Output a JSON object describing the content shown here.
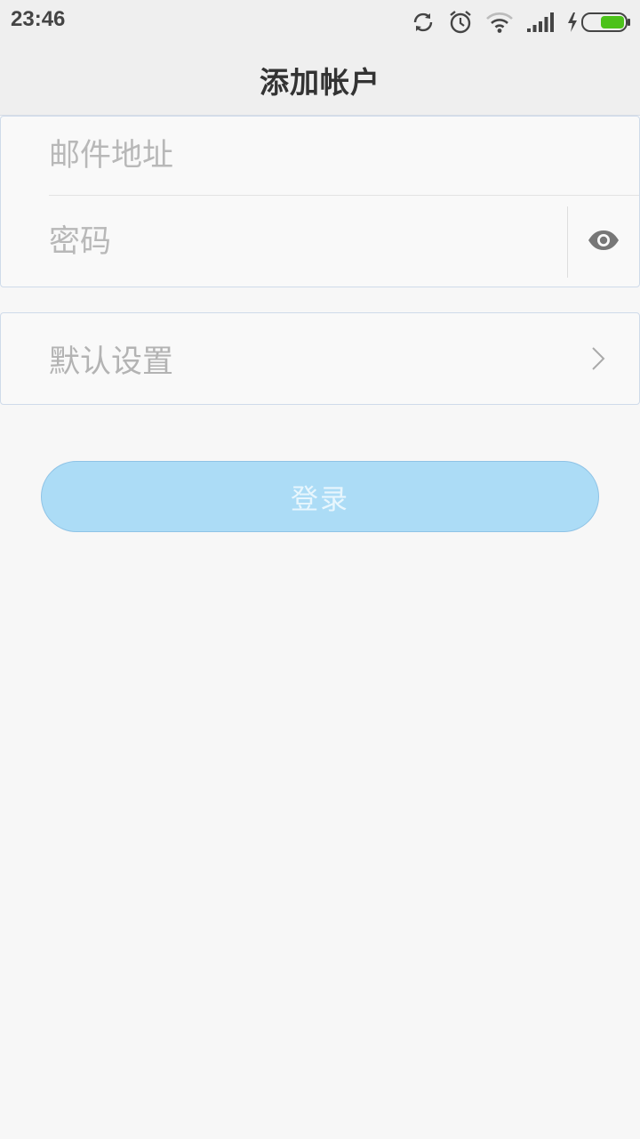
{
  "status_bar": {
    "time": "23:46",
    "icons": [
      "sync-icon",
      "alarm-icon",
      "wifi-icon",
      "signal-icon",
      "charging-icon",
      "battery-icon"
    ]
  },
  "header": {
    "title": "添加帐户"
  },
  "form": {
    "email_placeholder": "邮件地址",
    "email_value": "",
    "password_placeholder": "密码",
    "password_value": ""
  },
  "settings": {
    "label": "默认设置"
  },
  "login_button": {
    "label": "登录"
  },
  "colors": {
    "accent_button": "#acdcf6",
    "battery_green": "#4cc21a",
    "card_border": "#cfdbea"
  }
}
